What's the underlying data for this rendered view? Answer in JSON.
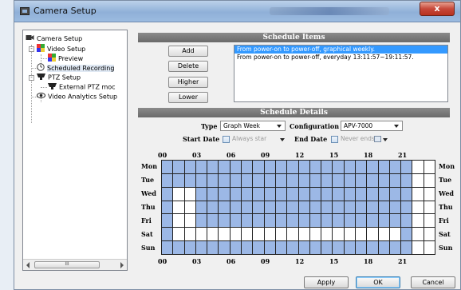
{
  "window": {
    "title": "Camera Setup",
    "close_label": "x"
  },
  "tree": {
    "nodes": [
      {
        "label": "Camera Setup",
        "icon": "camera-icon"
      },
      {
        "label": "Video Setup",
        "icon": "video-setup-icon"
      },
      {
        "label": "Preview",
        "icon": "preview-icon"
      },
      {
        "label": "Scheduled Recording",
        "icon": "clock-icon"
      },
      {
        "label": "PTZ Setup",
        "icon": "ptz-camera-icon"
      },
      {
        "label": "External PTZ moc",
        "icon": "ptz-camera-icon"
      },
      {
        "label": "Video Analytics Setup",
        "icon": "eye-icon"
      }
    ],
    "scroll_thumb_label": "III"
  },
  "schedule_items": {
    "header": "Schedule Items",
    "buttons": {
      "add": "Add",
      "delete": "Delete",
      "higher": "Higher",
      "lower": "Lower"
    },
    "items": [
      "From power-on to power-off, graphical weekly.",
      "From power-on to power-off, everyday 13:11:57~19:11:57."
    ]
  },
  "schedule_details": {
    "header": "Schedule Details",
    "type_label": "Type",
    "type_value": "Graph Week",
    "configuration_label": "Configuration",
    "configuration_value": "APV-7000",
    "start_date_label": "Start Date",
    "start_date_value": "Always star",
    "end_date_label": "End Date",
    "end_date_value": "Never ends"
  },
  "grid": {
    "hour_labels": [
      "00",
      "03",
      "06",
      "09",
      "12",
      "15",
      "18",
      "21"
    ],
    "days": [
      "Mon",
      "Tue",
      "Wed",
      "Thu",
      "Fri",
      "Sat",
      "Sun"
    ],
    "active_hours_by_day": [
      [
        0,
        1,
        2,
        3,
        4,
        5,
        6,
        7,
        8,
        9,
        10,
        11,
        12,
        13,
        14,
        15,
        16,
        17,
        18,
        19,
        20,
        21
      ],
      [
        0,
        1,
        2,
        3,
        4,
        5,
        6,
        7,
        8,
        9,
        10,
        11,
        12,
        13,
        14,
        15,
        16,
        17,
        18,
        19,
        20,
        21
      ],
      [
        0,
        3,
        4,
        5,
        6,
        7,
        8,
        9,
        10,
        11,
        12,
        13,
        14,
        15,
        16,
        17,
        18,
        19,
        20,
        21
      ],
      [
        0,
        3,
        4,
        5,
        6,
        7,
        8,
        9,
        10,
        11,
        12,
        13,
        14,
        15,
        16,
        17,
        18,
        19,
        20,
        21
      ],
      [
        0,
        3,
        4,
        5,
        6,
        7,
        8,
        9,
        10,
        11,
        12,
        13,
        14,
        15,
        16,
        17,
        18,
        19,
        20,
        21
      ],
      [
        0,
        21
      ],
      [
        0,
        1,
        2,
        3,
        4,
        5,
        6,
        7,
        8,
        9,
        10,
        11,
        12,
        13,
        14,
        15,
        16,
        17,
        18,
        19,
        20,
        21
      ]
    ],
    "active_color": "#9cb8e6"
  },
  "footer": {
    "apply": "Apply",
    "ok": "OK",
    "cancel": "Cancel"
  }
}
